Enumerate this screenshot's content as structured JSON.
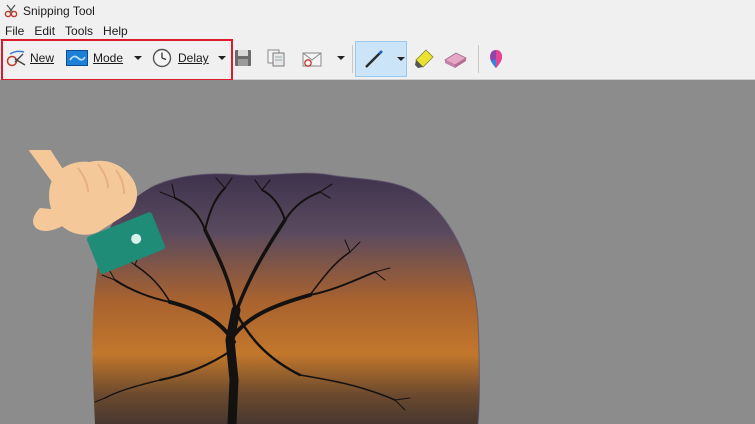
{
  "window": {
    "title": "Snipping Tool"
  },
  "menu": {
    "items": [
      "File",
      "Edit",
      "Tools",
      "Help"
    ]
  },
  "toolbar": {
    "new_label": "New",
    "mode_label": "Mode",
    "delay_label": "Delay"
  },
  "colors": {
    "highlight": "#e0182c",
    "canvas": "#8c8c8c",
    "cuff": "#1e8c77",
    "skin": "#f5c89a"
  },
  "icons": {
    "new": "scissors-icon",
    "mode": "mode-icon",
    "delay": "clock-icon",
    "save": "save-icon",
    "copy": "copy-icon",
    "send": "send-email-icon",
    "pen": "pen-icon",
    "highlighter": "highlighter-icon",
    "eraser": "eraser-icon",
    "paint3d": "paint3d-icon"
  }
}
